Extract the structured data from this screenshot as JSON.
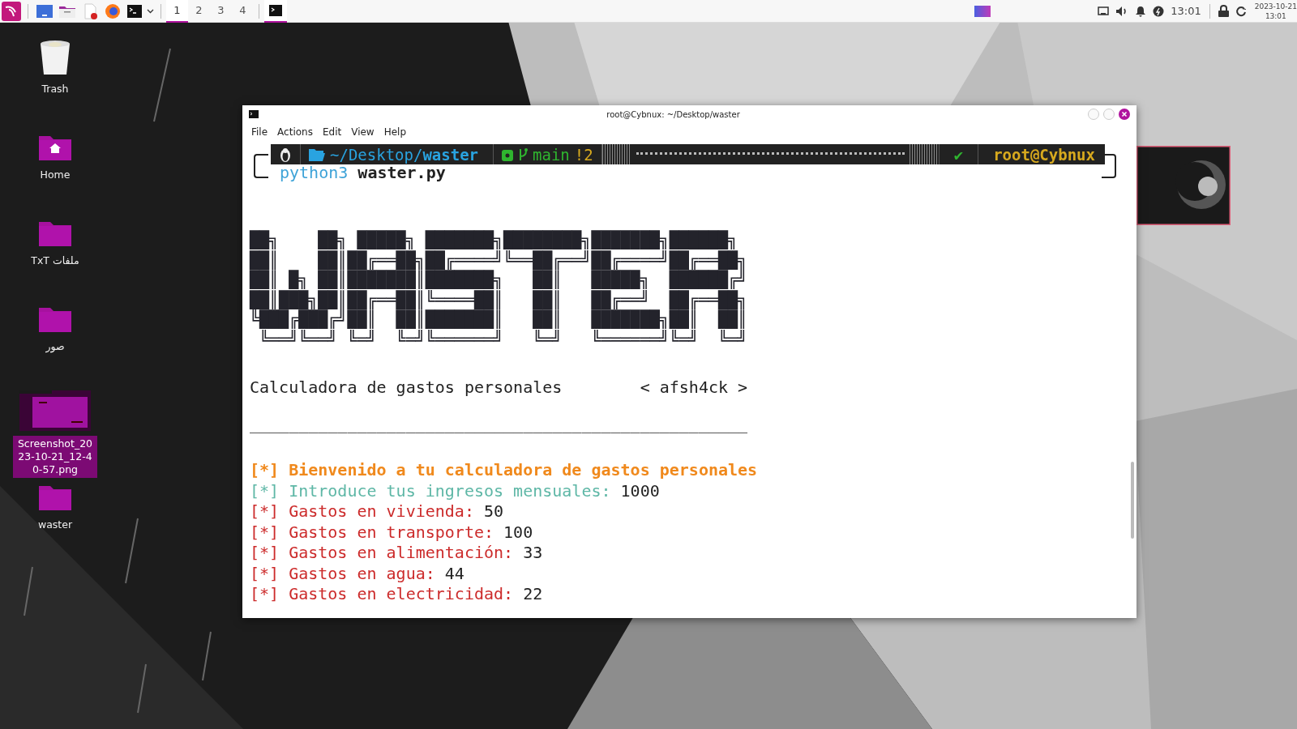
{
  "taskbar": {
    "workspaces": [
      {
        "label": "1",
        "selected": true
      },
      {
        "label": "2",
        "selected": false
      },
      {
        "label": "3",
        "selected": false
      },
      {
        "label": "4",
        "selected": false
      }
    ],
    "tasks": [
      {
        "selected": true
      }
    ],
    "clock": "13:01",
    "date": "2023-10-21",
    "date_time": "13:01"
  },
  "desktop_icons": [
    {
      "label": "Trash",
      "kind": "trash",
      "selected": false
    },
    {
      "label": "Home",
      "kind": "home",
      "selected": false
    },
    {
      "label": "ملفات TxT",
      "kind": "folder",
      "selected": false
    },
    {
      "label": "صور",
      "kind": "folder",
      "selected": false
    },
    {
      "label": "Screenshot_2023-10-21_12-40-57.png",
      "selected": true
    },
    {
      "label": "waster",
      "kind": "folder",
      "selected": false
    }
  ],
  "terminal": {
    "title": "root@Cybnux: ~/Desktop/waster",
    "menu": [
      "File",
      "Actions",
      "Edit",
      "View",
      "Help"
    ],
    "prompt": {
      "path_parent": "~/Desktop/",
      "path_dir": "waster",
      "branch": "main",
      "git_status": "!2",
      "status_mark": "✔",
      "user": "root@Cybnux"
    },
    "command": {
      "program": "python3",
      "argument": "waster.py"
    },
    "banner": [
      "██╗    ██╗ █████╗ ███████╗████████╗███████╗██████╗ ",
      "██║    ██║██╔══██╗██╔════╝╚══██╔══╝██╔════╝██╔══██╗",
      "██║ █╗ ██║███████║███████╗   ██║   █████╗  ██████╔╝",
      "██║███╗██║██╔══██║╚════██║   ██║   ██╔══╝  ██╔══██╗",
      "╚███╔███╔╝██║  ██║███████║   ██║   ███████╗██║  ██║",
      " ╚══╝╚══╝ ╚═╝  ╚═╝╚══════╝   ╚═╝   ╚══════╝╚═╝  ╚═╝"
    ],
    "subtitle": "Calculadora de gastos personales",
    "author": "< afsh4ck >",
    "rule": "___________________________________________________",
    "output": [
      {
        "kind": "heading",
        "text": "[*] Bienvenido a tu calculadora de gastos personales",
        "color": "#f0891c"
      },
      {
        "kind": "prompt",
        "text": "[*] Introduce tus ingresos mensuales:",
        "value": "1000",
        "color": "#5eb7a6"
      },
      {
        "kind": "prompt",
        "text": "[*] Gastos en vivienda:",
        "value": "50",
        "color": "#cc2b2b"
      },
      {
        "kind": "prompt",
        "text": "[*] Gastos en transporte:",
        "value": "100",
        "color": "#cc2b2b"
      },
      {
        "kind": "prompt",
        "text": "[*] Gastos en alimentación:",
        "value": "33",
        "color": "#cc2b2b"
      },
      {
        "kind": "prompt",
        "text": "[*] Gastos en agua:",
        "value": "44",
        "color": "#cc2b2b"
      },
      {
        "kind": "prompt",
        "text": "[*] Gastos en electricidad:",
        "value": "22",
        "color": "#cc2b2b"
      }
    ]
  }
}
